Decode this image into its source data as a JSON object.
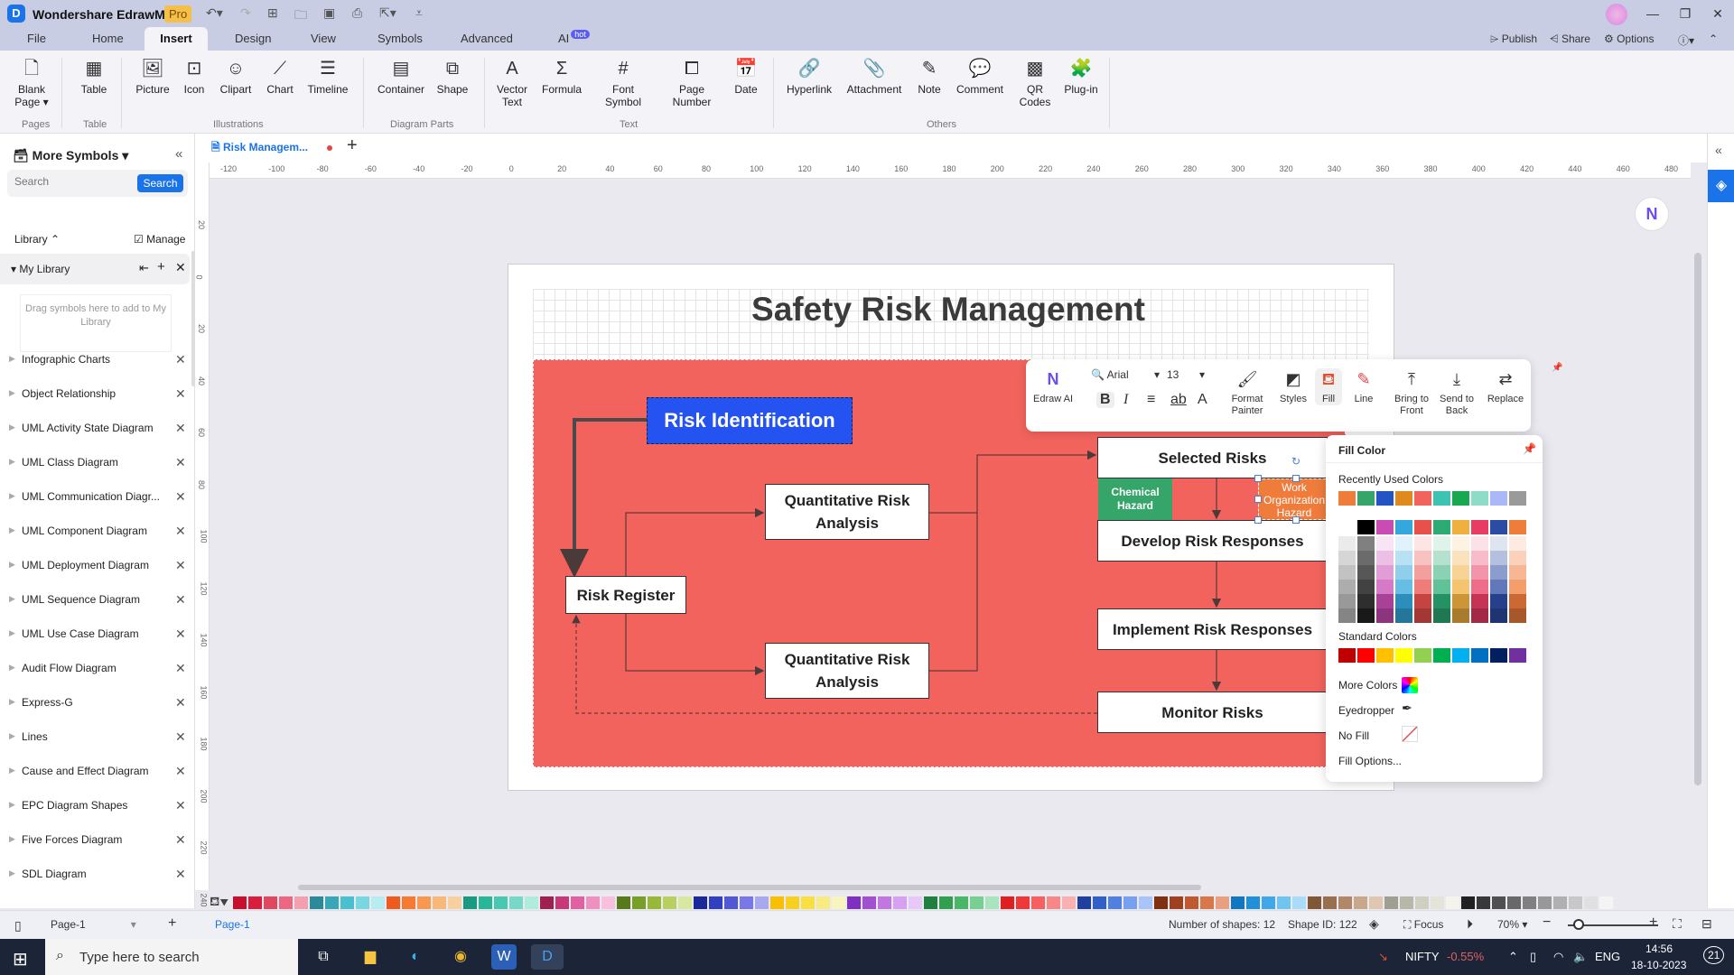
{
  "app": {
    "title": "Wondershare EdrawMax",
    "badge": "Pro"
  },
  "quick_access": [
    "undo-icon",
    "redo-icon",
    "new-icon",
    "open-icon",
    "save-icon",
    "print-icon",
    "export-icon",
    "customize-icon"
  ],
  "menu_tabs": [
    {
      "label": "File"
    },
    {
      "label": "Home"
    },
    {
      "label": "Insert",
      "active": true
    },
    {
      "label": "Design"
    },
    {
      "label": "View"
    },
    {
      "label": "Symbols"
    },
    {
      "label": "Advanced"
    },
    {
      "label": "AI",
      "badge": "hot"
    }
  ],
  "header_right": {
    "publish": "Publish",
    "share": "Share",
    "options": "Options"
  },
  "ribbon": {
    "buttons": [
      {
        "label": "Blank Page",
        "icon": "page-icon"
      },
      {
        "label": "Table",
        "icon": "table-icon"
      },
      {
        "label": "Picture",
        "icon": "picture-icon"
      },
      {
        "label": "Icon",
        "icon": "icon-icon"
      },
      {
        "label": "Clipart",
        "icon": "clipart-icon"
      },
      {
        "label": "Chart",
        "icon": "chart-icon"
      },
      {
        "label": "Timeline",
        "icon": "timeline-icon"
      },
      {
        "label": "Container",
        "icon": "container-icon"
      },
      {
        "label": "Shape",
        "icon": "shape-icon"
      },
      {
        "label": "Vector Text",
        "icon": "vector-text-icon"
      },
      {
        "label": "Formula",
        "icon": "formula-icon"
      },
      {
        "label": "Font Symbol",
        "icon": "hash-icon"
      },
      {
        "label": "Page Number",
        "icon": "page-number-icon"
      },
      {
        "label": "Date",
        "icon": "date-icon"
      },
      {
        "label": "Hyperlink",
        "icon": "hyperlink-icon"
      },
      {
        "label": "Attachment",
        "icon": "attachment-icon"
      },
      {
        "label": "Note",
        "icon": "note-icon"
      },
      {
        "label": "Comment",
        "icon": "comment-icon"
      },
      {
        "label": "QR Codes",
        "icon": "qr-icon"
      },
      {
        "label": "Plug-in",
        "icon": "plugin-icon"
      }
    ],
    "groups": [
      "Pages",
      "Table",
      "Illustrations",
      "Diagram Parts",
      "Text",
      "Others"
    ]
  },
  "left_panel": {
    "title": "More Symbols",
    "search_placeholder": "Search",
    "search_button": "Search",
    "library_label": "Library",
    "manage_label": "Manage",
    "my_library": "My Library",
    "drop_hint": "Drag symbols here to add to My Library",
    "libraries": [
      "Infographic Charts",
      "Object Relationship",
      "UML Activity State Diagram",
      "UML Class Diagram",
      "UML Communication Diagr...",
      "UML Component Diagram",
      "UML Deployment Diagram",
      "UML Sequence Diagram",
      "UML Use Case Diagram",
      "Audit Flow Diagram",
      "Express-G",
      "Lines",
      "Cause and Effect Diagram",
      "EPC Diagram Shapes",
      "Five Forces Diagram",
      "SDL Diagram"
    ]
  },
  "document_tab": {
    "label": "Risk Managem...",
    "unsaved": true
  },
  "ruler": {
    "h_ticks": [
      "-120",
      "-100",
      "-80",
      "-60",
      "-40",
      "-20",
      "0",
      "20",
      "40",
      "60",
      "80",
      "100",
      "120",
      "140",
      "160",
      "180",
      "200",
      "220",
      "240",
      "260",
      "280",
      "300",
      "320",
      "340",
      "360",
      "380",
      "400",
      "420",
      "440",
      "460",
      "480"
    ],
    "v_ticks": [
      "20",
      "0",
      "20",
      "40",
      "60",
      "80",
      "100",
      "120",
      "140",
      "160",
      "180",
      "200",
      "220",
      "240"
    ]
  },
  "diagram": {
    "title": "Safety Risk Management",
    "risk_identification": "Risk Identification",
    "risk_register": "Risk Register",
    "qra_top": "Quantitative Risk Analysis",
    "qra_bottom": "Quantitative Risk Analysis",
    "selected_risks": "Selected Risks",
    "chemical_hazard": "Chemical Hazard",
    "work_hazard": "Work Organization Hazard",
    "develop": "Develop Risk Responses",
    "implement": "Implement Risk Responses",
    "monitor": "Monitor Risks",
    "colors": {
      "background": "#f2635d",
      "risk_id": "#2453f2",
      "chemical": "#35a56a",
      "work": "#f07c3c"
    }
  },
  "floating_toolbar": {
    "edraw_ai": "Edraw AI",
    "font": "Arial",
    "size": "13",
    "format_painter": "Format Painter",
    "styles": "Styles",
    "fill": "Fill",
    "line": "Line",
    "bring_front": "Bring to Front",
    "send_back": "Send to Back",
    "replace": "Replace"
  },
  "fill_popup": {
    "title": "Fill Color",
    "recent_label": "Recently Used Colors",
    "recent": [
      "#f07c3c",
      "#35a56a",
      "#2453c4",
      "#e08a1e",
      "#f2635d",
      "#3cc4b0",
      "#17a850",
      "#8cdcc8",
      "#aab8f8",
      "#9a9a9a"
    ],
    "theme_top": [
      "#ffffff",
      "#000000",
      "#c84cb4",
      "#34a8dc",
      "#e8504c",
      "#2cac74",
      "#f0b040",
      "#e83c64",
      "#2c4ca4",
      "#f07c3c"
    ],
    "standard_label": "Standard Colors",
    "standard": [
      "#c00000",
      "#ff0000",
      "#ffc000",
      "#ffff00",
      "#92d050",
      "#00b050",
      "#00b0f0",
      "#0070c0",
      "#002060",
      "#7030a0"
    ],
    "more_colors": "More Colors",
    "eyedropper": "Eyedropper",
    "no_fill": "No Fill",
    "fill_options": "Fill Options..."
  },
  "palette_strip": [
    "#c8102e",
    "#d81e3c",
    "#e04860",
    "#ec6882",
    "#f4a0b0",
    "#2a8a9a",
    "#38a8b8",
    "#48c0d0",
    "#78d8e0",
    "#b8ecf0",
    "#f05a1e",
    "#f87a30",
    "#f89850",
    "#f8b878",
    "#f8d0a0",
    "#1a9a80",
    "#28b898",
    "#48c8b0",
    "#78d8c8",
    "#b0ecdc",
    "#a02050",
    "#c83878",
    "#e060a0",
    "#f090c0",
    "#f8c0dc",
    "#587a1a",
    "#78a028",
    "#98b838",
    "#b8d060",
    "#d8e8a0",
    "#1a2a9a",
    "#3040c0",
    "#5058d8",
    "#7878e8",
    "#a8a8f0",
    "#f8c000",
    "#f8d020",
    "#f8e040",
    "#f8ec80",
    "#f8f4c0",
    "#8030c0",
    "#a050d0",
    "#c078e0",
    "#d8a0f0",
    "#e8c8f8",
    "#208040",
    "#30a050",
    "#48b868",
    "#78d090",
    "#a8e4bc",
    "#e02020",
    "#f03838",
    "#f86060",
    "#f88888",
    "#f8b0b0",
    "#2040a0",
    "#3060c8",
    "#5080e0",
    "#78a0f0",
    "#a8c4f8",
    "#803010",
    "#a04020",
    "#c05830",
    "#d87848",
    "#e8a080",
    "#1078c0",
    "#2090d8",
    "#40a8e8",
    "#70c4f0",
    "#a8dcf8",
    "#805838",
    "#987050",
    "#b08868",
    "#c8a888",
    "#e0c8b0",
    "#a0a090",
    "#b8b8a8",
    "#d0d0c0",
    "#e4e4d8",
    "#f4f4ec",
    "#202020",
    "#383838",
    "#505050",
    "#686868",
    "#808080",
    "#989898",
    "#b0b0b0",
    "#c8c8c8",
    "#e0e0e0",
    "#f4f4f4"
  ],
  "status_bar": {
    "page_selector": "Page-1",
    "page_tab": "Page-1",
    "shape_count": "Number of shapes: 12",
    "shape_id": "Shape ID: 122",
    "focus": "Focus",
    "zoom": "70%"
  },
  "taskbar": {
    "search_placeholder": "Type here to search",
    "nifty": "NIFTY",
    "nifty_change": "-0.55%",
    "lang": "ENG",
    "time": "14:56",
    "date": "18-10-2023",
    "notifications": "21"
  }
}
